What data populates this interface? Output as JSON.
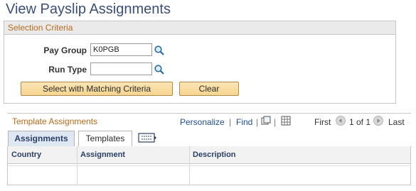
{
  "page": {
    "title": "View Payslip Assignments"
  },
  "selection": {
    "header": "Selection Criteria",
    "pay_group_label": "Pay Group",
    "pay_group_value": "K0PGB",
    "run_type_label": "Run Type",
    "run_type_value": "",
    "select_button": "Select with Matching Criteria",
    "clear_button": "Clear"
  },
  "grid": {
    "title": "Template Assignments",
    "personalize": "Personalize",
    "separator": "|",
    "find": "Find",
    "first": "First",
    "range": "1 of 1",
    "last": "Last",
    "tabs": [
      {
        "label": "Assignments",
        "active": true
      },
      {
        "label": "Templates",
        "active": false
      }
    ],
    "columns": [
      "Country",
      "Assignment",
      "Description"
    ],
    "rows": []
  },
  "icons": {
    "lookup": "magnifier-icon",
    "view_all": "view-all-icon",
    "download": "spreadsheet-icon",
    "show_all_columns": "show-all-columns-icon",
    "prev": "previous-arrow-icon",
    "next": "next-arrow-icon"
  },
  "colors": {
    "title": "#3c4f77",
    "section_header": "#b56c1d",
    "link": "#1f4e8f",
    "button_fill": "#f6d58f"
  }
}
